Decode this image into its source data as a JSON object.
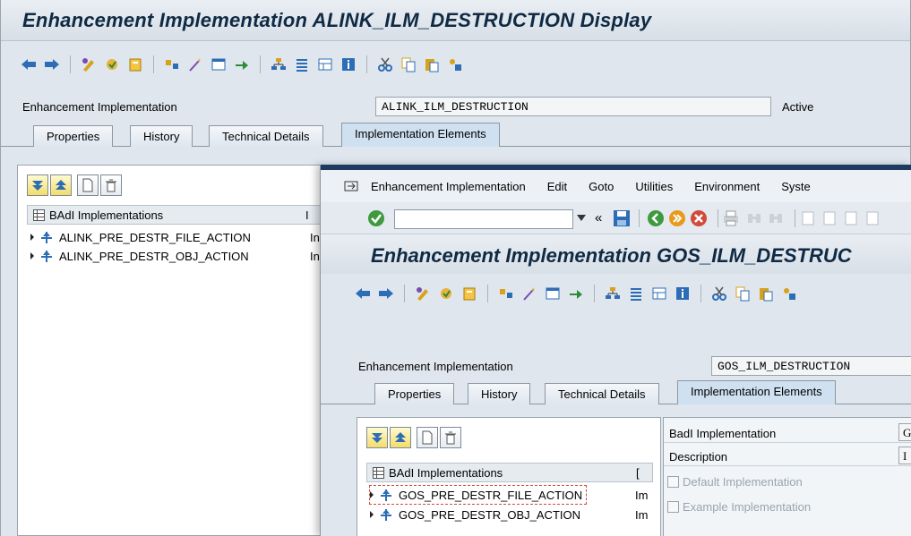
{
  "back_window": {
    "title": "Enhancement Implementation ALINK_ILM_DESTRUCTION Display",
    "field_label": "Enhancement Implementation",
    "field_value": "ALINK_ILM_DESTRUCTION",
    "status": "Active",
    "tabs": [
      {
        "label": "Properties"
      },
      {
        "label": "History"
      },
      {
        "label": "Technical Details"
      },
      {
        "label": "Implementation Elements"
      }
    ],
    "tree": {
      "header": "BAdI Implementations",
      "header_col2": "I",
      "rows": [
        {
          "name": "ALINK_PRE_DESTR_FILE_ACTION",
          "col2": "In"
        },
        {
          "name": "ALINK_PRE_DESTR_OBJ_ACTION",
          "col2": "In"
        }
      ]
    }
  },
  "front_window": {
    "menu": [
      {
        "label": "Enhancement Implementation"
      },
      {
        "label": "Edit"
      },
      {
        "label": "Goto"
      },
      {
        "label": "Utilities"
      },
      {
        "label": "Environment"
      },
      {
        "label": "Syste"
      }
    ],
    "command_field_value": "",
    "back_glyph": "«",
    "title": "Enhancement Implementation GOS_ILM_DESTRUC",
    "field_label": "Enhancement Implementation",
    "field_value": "GOS_ILM_DESTRUCTION",
    "tabs": [
      {
        "label": "Properties"
      },
      {
        "label": "History"
      },
      {
        "label": "Technical Details"
      },
      {
        "label": "Implementation Elements"
      }
    ],
    "tree": {
      "header": "BAdI Implementations",
      "header_col2": "[",
      "rows": [
        {
          "name": "GOS_PRE_DESTR_FILE_ACTION",
          "col2": "Im"
        },
        {
          "name": "GOS_PRE_DESTR_OBJ_ACTION",
          "col2": "Im"
        }
      ]
    },
    "details": {
      "badi_impl_label": "BadI Implementation",
      "badi_impl_value": "G",
      "description_label": "Description",
      "description_value": "I",
      "default_impl_label": "Default Implementation",
      "example_impl_label": "Example Implementation"
    }
  },
  "colors": {
    "title_text": "#102a44",
    "active_tab": "#cfe0f0",
    "front_bar": "#1e3a5f"
  }
}
